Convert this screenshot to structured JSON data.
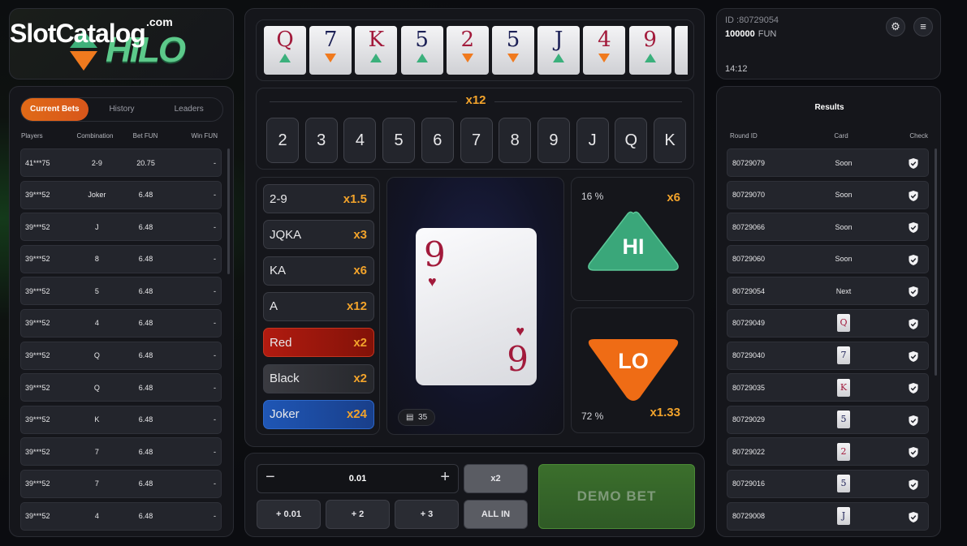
{
  "logo": {
    "brand": "SlotCatalog",
    "brand_suffix": ".com",
    "game": "HILO"
  },
  "bets_tabs": [
    "Current Bets",
    "History",
    "Leaders"
  ],
  "bets_columns": [
    "Players",
    "Combination",
    "Bet FUN",
    "Win FUN"
  ],
  "bets_rows": [
    {
      "player": "41***75",
      "combo": "2-9",
      "bet": "20.75",
      "win": "-"
    },
    {
      "player": "39***52",
      "combo": "Joker",
      "bet": "6.48",
      "win": "-"
    },
    {
      "player": "39***52",
      "combo": "J",
      "bet": "6.48",
      "win": "-"
    },
    {
      "player": "39***52",
      "combo": "8",
      "bet": "6.48",
      "win": "-"
    },
    {
      "player": "39***52",
      "combo": "5",
      "bet": "6.48",
      "win": "-"
    },
    {
      "player": "39***52",
      "combo": "4",
      "bet": "6.48",
      "win": "-"
    },
    {
      "player": "39***52",
      "combo": "Q",
      "bet": "6.48",
      "win": "-"
    },
    {
      "player": "39***52",
      "combo": "Q",
      "bet": "6.48",
      "win": "-"
    },
    {
      "player": "39***52",
      "combo": "K",
      "bet": "6.48",
      "win": "-"
    },
    {
      "player": "39***52",
      "combo": "7",
      "bet": "6.48",
      "win": "-"
    },
    {
      "player": "39***52",
      "combo": "7",
      "bet": "6.48",
      "win": "-"
    },
    {
      "player": "39***52",
      "combo": "4",
      "bet": "6.48",
      "win": "-"
    }
  ],
  "history_cards": [
    {
      "rank": "Q",
      "color": "#a21a3b",
      "dir": "up"
    },
    {
      "rank": "7",
      "color": "#1b1f55",
      "dir": "down"
    },
    {
      "rank": "K",
      "color": "#a21a3b",
      "dir": "up"
    },
    {
      "rank": "5",
      "color": "#1b1f55",
      "dir": "up"
    },
    {
      "rank": "2",
      "color": "#a21a3b",
      "dir": "down"
    },
    {
      "rank": "5",
      "color": "#1b1f55",
      "dir": "down"
    },
    {
      "rank": "J",
      "color": "#1b1f55",
      "dir": "up"
    },
    {
      "rank": "4",
      "color": "#a21a3b",
      "dir": "down"
    },
    {
      "rank": "9",
      "color": "#a21a3b",
      "dir": "up"
    }
  ],
  "rank_multiplier": "x12",
  "ranks": [
    "2",
    "3",
    "4",
    "5",
    "6",
    "7",
    "8",
    "9",
    "J",
    "Q",
    "K"
  ],
  "odds": [
    {
      "label": "2-9",
      "mult": "x1.5",
      "style": ""
    },
    {
      "label": "JQKA",
      "mult": "x3",
      "style": ""
    },
    {
      "label": "KA",
      "mult": "x6",
      "style": ""
    },
    {
      "label": "A",
      "mult": "x12",
      "style": ""
    },
    {
      "label": "Red",
      "mult": "x2",
      "style": "red"
    },
    {
      "label": "Black",
      "mult": "x2",
      "style": "black"
    },
    {
      "label": "Joker",
      "mult": "x24",
      "style": "joker"
    }
  ],
  "current_card": {
    "rank": "9",
    "suit": "♥",
    "color": "#a21a3b"
  },
  "deck_count": "35",
  "hi": {
    "percent": "16 %",
    "mult": "x6",
    "label": "HI",
    "color": "#3aa77a"
  },
  "lo": {
    "percent": "72 %",
    "mult": "x1.33",
    "label": "LO",
    "color": "#ef6c15"
  },
  "stake": {
    "minus": "−",
    "value": "0.01",
    "plus": "+"
  },
  "bet_buttons": {
    "double": "x2",
    "plus_001": "+ 0.01",
    "plus_2": "+ 2",
    "plus_3": "+ 3",
    "all_in": "ALL IN",
    "demo_bet": "DEMO BET"
  },
  "account": {
    "id": "ID :80729054",
    "balance": "100000",
    "currency": "FUN",
    "time": "14:12"
  },
  "results_title": "Results",
  "results_columns": [
    "Round ID",
    "Card",
    "Check"
  ],
  "results_rows": [
    {
      "round": "80729079",
      "card": "Soon",
      "is_card": false,
      "color": ""
    },
    {
      "round": "80729070",
      "card": "Soon",
      "is_card": false,
      "color": ""
    },
    {
      "round": "80729066",
      "card": "Soon",
      "is_card": false,
      "color": ""
    },
    {
      "round": "80729060",
      "card": "Soon",
      "is_card": false,
      "color": ""
    },
    {
      "round": "80729054",
      "card": "Next",
      "is_card": false,
      "color": ""
    },
    {
      "round": "80729049",
      "card": "Q",
      "is_card": true,
      "color": "#a21a3b"
    },
    {
      "round": "80729040",
      "card": "7",
      "is_card": true,
      "color": "#1b1f55"
    },
    {
      "round": "80729035",
      "card": "K",
      "is_card": true,
      "color": "#a21a3b"
    },
    {
      "round": "80729029",
      "card": "5",
      "is_card": true,
      "color": "#1b1f55"
    },
    {
      "round": "80729022",
      "card": "2",
      "is_card": true,
      "color": "#a21a3b"
    },
    {
      "round": "80729016",
      "card": "5",
      "is_card": true,
      "color": "#1b1f55"
    },
    {
      "round": "80729008",
      "card": "J",
      "is_card": true,
      "color": "#1b1f55"
    }
  ]
}
